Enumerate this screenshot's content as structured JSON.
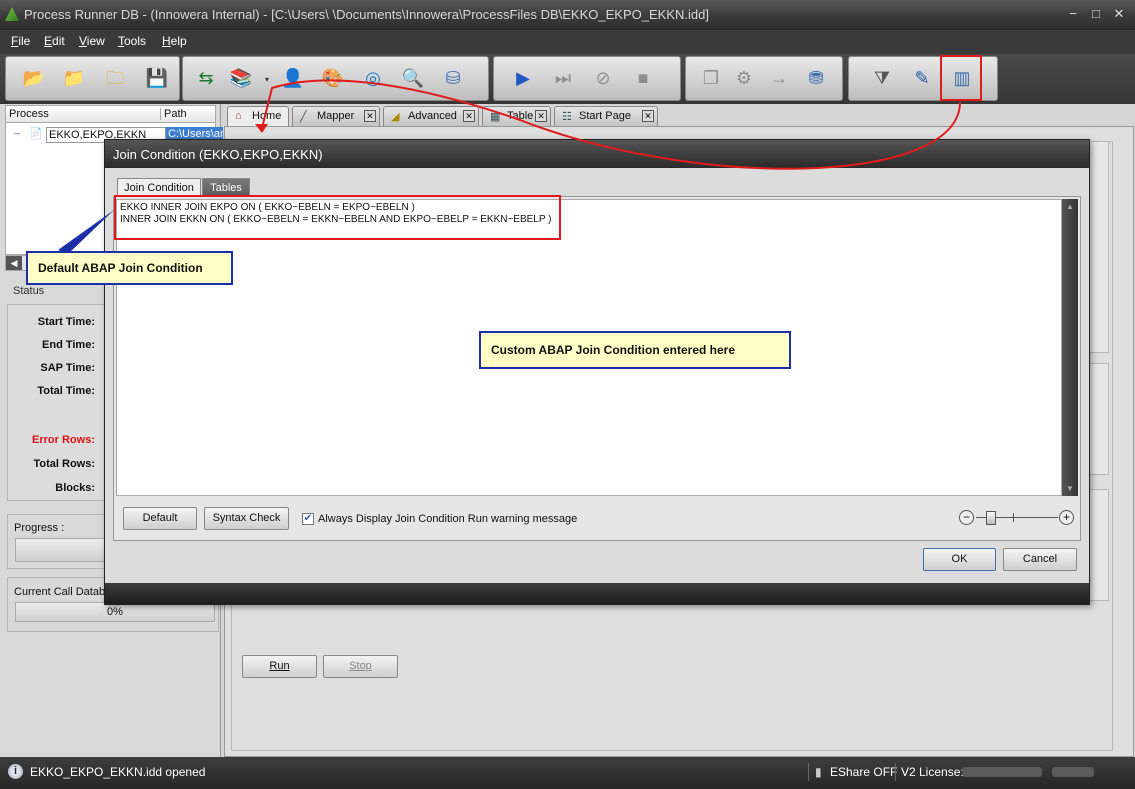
{
  "window": {
    "title": "Process Runner DB - (Innowera Internal) - [C:\\Users\\        \\Documents\\Innowera\\ProcessFiles DB\\EKKO_EKPO_EKKN.idd]",
    "minimize_icon": "minimize-icon",
    "maximize_icon": "maximize-icon",
    "close_icon": "close-icon"
  },
  "menu": [
    "File",
    "Edit",
    "View",
    "Tools",
    "Help"
  ],
  "toolbar": {
    "group1": [
      "open-folder-icon",
      "folder-icon",
      "folder-open-icon",
      "save-icon"
    ],
    "group2": [
      "transfer-icon",
      "books-icon",
      "user-icon",
      "palette-icon",
      "disk-icon",
      "server-search-icon",
      "database-icon"
    ],
    "group3": [
      "play-icon",
      "step-icon",
      "stop-step-icon",
      "stop-icon"
    ],
    "group4": [
      "copy-icon",
      "run-config-icon",
      "connection-icon",
      "transfer-db-icon"
    ],
    "group5": [
      "filter-icon",
      "edit-document-icon",
      "join-condition-icon"
    ]
  },
  "process_panel": {
    "col_process": "Process",
    "col_path": "Path",
    "row_name": "EKKO,EKPO,EKKN",
    "row_path": "C:\\Users\\an"
  },
  "status": {
    "label": "Status",
    "start_time": "Start Time:",
    "end_time": "End Time:",
    "sap_time": "SAP Time:",
    "total_time": "Total Time:",
    "error_rows": "Error Rows:",
    "total_rows": "Total Rows:",
    "blocks": "Blocks:",
    "progress_label": "Progress :",
    "current_call": "Current Call Database:",
    "current_call_pct": "0%"
  },
  "tabs": [
    {
      "label": "Home",
      "icon": "home-icon"
    },
    {
      "label": "Mapper",
      "icon": "mapper-icon"
    },
    {
      "label": "Advanced",
      "icon": "advanced-icon"
    },
    {
      "label": "Table",
      "icon": "table-icon"
    },
    {
      "label": "Start Page",
      "icon": "start-page-icon"
    }
  ],
  "main": {
    "run_label": "Run",
    "stop_label": "Stop"
  },
  "dialog": {
    "title": "Join Condition (EKKO,EKPO,EKKN)",
    "tab_join": "Join Condition",
    "tab_tables": "Tables",
    "line1": "EKKO INNER JOIN EKPO ON ( EKKO~EBELN = EKPO~EBELN )",
    "line2": "INNER JOIN EKKN ON ( EKKO~EBELN = EKKN~EBELN AND EKPO~EBELP = EKKN~EBELP )",
    "default_label": "Default",
    "syntax_label": "Syntax Check",
    "always_display": "Always Display Join Condition Run warning message",
    "always_display_checked": true,
    "ok_label": "OK",
    "cancel_label": "Cancel"
  },
  "callouts": {
    "default_abap": "Default ABAP Join Condition",
    "custom_abap": "Custom ABAP Join Condition entered here"
  },
  "statusbar": {
    "message": "EKKO_EKPO_EKKN.idd opened",
    "eshare": "EShare OFF",
    "license": "V2 License:"
  },
  "colors": {
    "annotation_red": "#e01b1b",
    "callout_border": "#1b2fa8",
    "callout_fill": "#ffffc6"
  }
}
